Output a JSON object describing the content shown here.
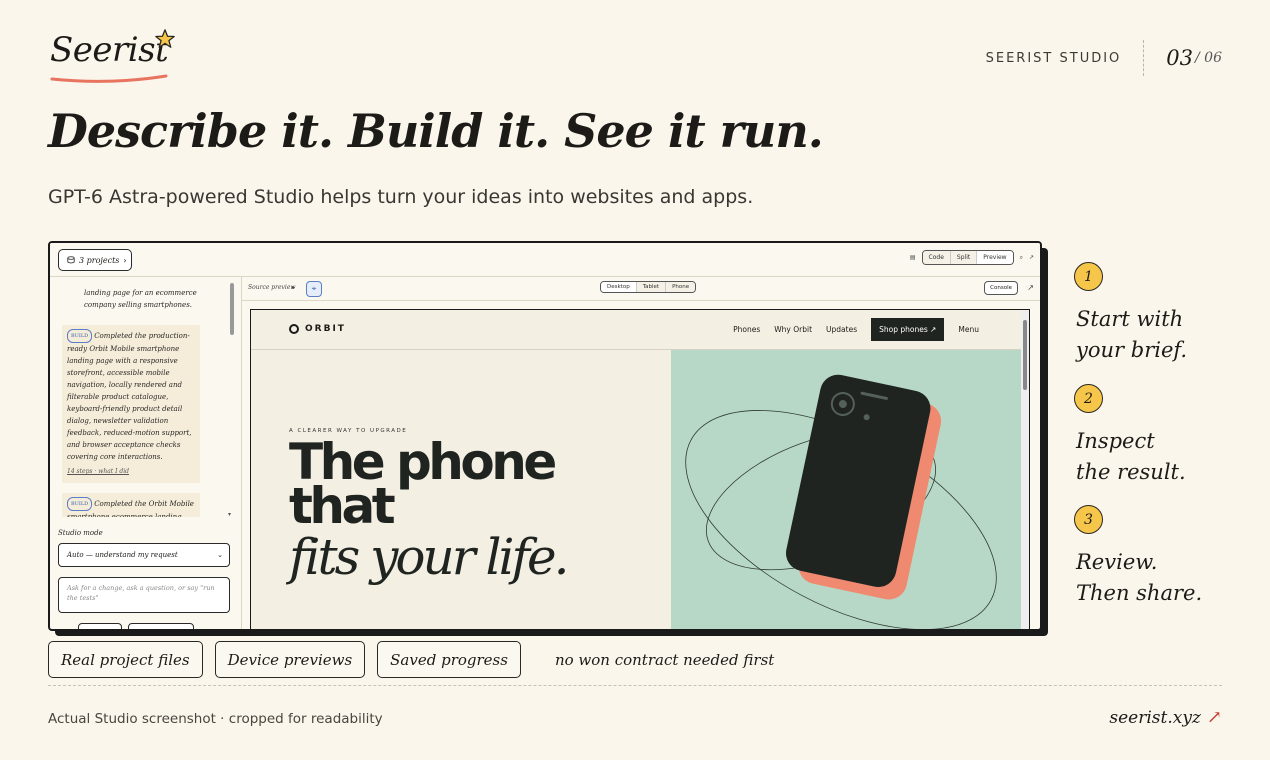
{
  "brand": {
    "logo_text": "Seerist",
    "studio_label": "SEERIST STUDIO",
    "page_current": "03",
    "page_total": "/ 06",
    "accent": "#f6c64a",
    "underline_color": "#e8745f"
  },
  "headline": "Describe it. Build it. See it run.",
  "subline": "GPT-6 Astra-powered Studio helps turn your ideas into websites and apps.",
  "studio": {
    "projects_button": "3 projects",
    "toolbar_tabs": [
      "Code",
      "Split",
      "Preview"
    ],
    "chat_intro": "landing page for an ecommerce company selling smartphones.",
    "chat_card1_badge": "BUILD",
    "chat_card1_text": "Completed the production-ready Orbit Mobile smartphone landing page with a responsive storefront, accessible mobile navigation, locally rendered and filterable product catalogue, keyboard-friendly product detail dialog, newsletter validation feedback, reduced-motion support, and browser acceptance checks covering core interactions.",
    "chat_card1_link": "14 steps · what I did",
    "chat_card2_badge": "BUILD",
    "chat_card2_text": "Completed the Orbit Mobile smartphone ecommerce landing page",
    "mode_label": "Studio mode",
    "mode_value": "Auto — understand my request",
    "prompt_placeholder": "Ask for a change, ask a question, or say \"run the tests\"",
    "source_preview_label": "Source preview",
    "device_tabs": [
      "Desktop",
      "Tablet",
      "Phone"
    ],
    "console_button": "Console"
  },
  "site": {
    "logo": "ORBIT",
    "nav_links": [
      "Phones",
      "Why Orbit",
      "Updates"
    ],
    "shop_button": "Shop phones ↗",
    "menu_link": "Menu",
    "eyebrow": "A CLEARER WAY TO UPGRADE",
    "hero_line1": "The phone",
    "hero_line2": "that",
    "hero_line3": "fits your life.",
    "art_bg": "#b7d8c6",
    "phone_color": "#1f2421",
    "phone_shadow": "#ef8a70"
  },
  "steps": [
    {
      "num": "1",
      "line1": "Start with",
      "line2": "your brief."
    },
    {
      "num": "2",
      "line1": "Inspect",
      "line2": "the result."
    },
    {
      "num": "3",
      "line1": "Review.",
      "line2": "Then share."
    }
  ],
  "pills": [
    "Real project files",
    "Device previews",
    "Saved progress"
  ],
  "pill_note": "no won contract needed first",
  "footer": {
    "caption": "Actual Studio screenshot · cropped for readability",
    "link": "seerist.xyz"
  }
}
